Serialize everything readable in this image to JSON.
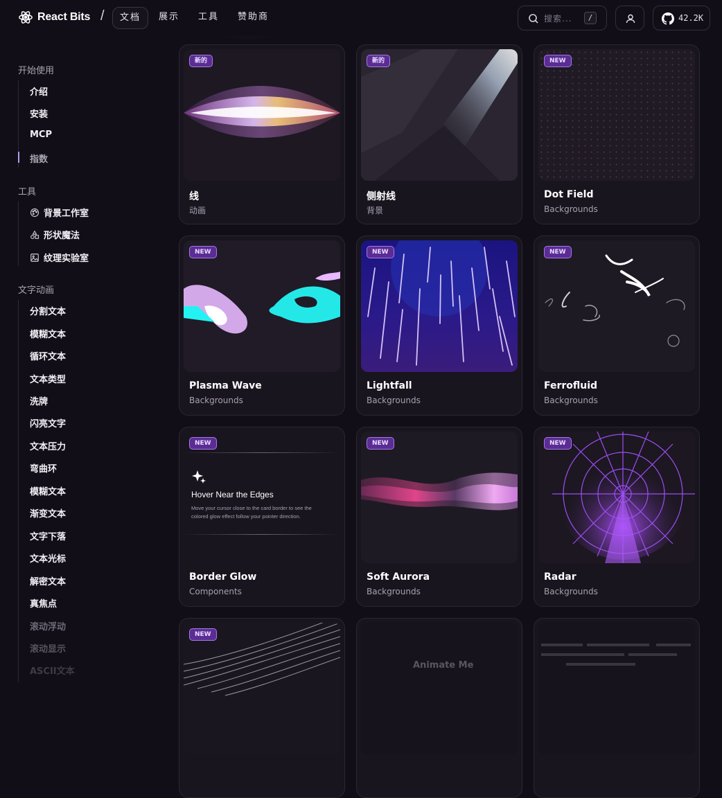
{
  "brand": {
    "name": "React Bits"
  },
  "header": {
    "separator": "/",
    "tabs": [
      {
        "label": "文档",
        "active": true
      },
      {
        "label": "展示",
        "active": false
      },
      {
        "label": "工具",
        "active": false
      },
      {
        "label": "赞助商",
        "active": false
      }
    ],
    "search": {
      "placeholder": "搜索...",
      "shortcut": "/"
    },
    "github": {
      "stars": "42.2K",
      "icon": "github-icon"
    },
    "user_icon": "user-icon"
  },
  "sidebar": {
    "sections": [
      {
        "title": "开始使用",
        "items": [
          {
            "label": "介绍"
          },
          {
            "label": "安装"
          },
          {
            "label": "MCP"
          },
          {
            "label": "指数",
            "active": true
          }
        ]
      },
      {
        "title": "工具",
        "items": [
          {
            "label": "背景工作室",
            "icon": "palette-icon"
          },
          {
            "label": "形状魔法",
            "icon": "shapes-icon"
          },
          {
            "label": "纹理实验室",
            "icon": "image-icon"
          }
        ]
      },
      {
        "title": "文字动画",
        "items": [
          {
            "label": "分割文本"
          },
          {
            "label": "模糊文本"
          },
          {
            "label": "循环文本"
          },
          {
            "label": "文本类型"
          },
          {
            "label": "洗牌"
          },
          {
            "label": "闪亮文字"
          },
          {
            "label": "文本压力"
          },
          {
            "label": "弯曲环"
          },
          {
            "label": "模糊文本"
          },
          {
            "label": "渐变文本"
          },
          {
            "label": "文字下落"
          },
          {
            "label": "文本光标"
          },
          {
            "label": "解密文本"
          },
          {
            "label": "真焦点"
          },
          {
            "label": "滚动浮动"
          },
          {
            "label": "滚动显示"
          },
          {
            "label": "ASCII文本"
          }
        ]
      }
    ]
  },
  "cards": [
    {
      "title": "线",
      "category": "动画",
      "badge": "新的"
    },
    {
      "title": "侧射线",
      "category": "背景",
      "badge": "新的"
    },
    {
      "title": "Dot Field",
      "category": "Backgrounds",
      "badge": "NEW"
    },
    {
      "title": "Plasma Wave",
      "category": "Backgrounds",
      "badge": "NEW"
    },
    {
      "title": "Lightfall",
      "category": "Backgrounds",
      "badge": "NEW"
    },
    {
      "title": "Ferrofluid",
      "category": "Backgrounds",
      "badge": "NEW"
    },
    {
      "title": "Border Glow",
      "category": "Components",
      "badge": "NEW",
      "preview_text": {
        "heading": "Hover Near the Edges",
        "body_line1": "Move your cursor close to the card border to see the",
        "body_line2": "colored glow effect follow your pointer direction."
      }
    },
    {
      "title": "Soft Aurora",
      "category": "Backgrounds",
      "badge": "NEW"
    },
    {
      "title": "Radar",
      "category": "Backgrounds",
      "badge": "NEW"
    },
    {
      "title": "",
      "category": "",
      "badge": "NEW"
    },
    {
      "title": "",
      "category": "",
      "badge": "",
      "preview_text": {
        "label": "Animate Me"
      }
    },
    {
      "title": "",
      "category": "",
      "badge": ""
    }
  ]
}
